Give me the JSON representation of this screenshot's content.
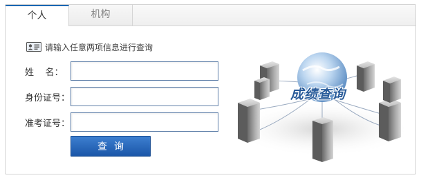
{
  "tabs": [
    {
      "label": "个人",
      "active": true
    },
    {
      "label": "机构",
      "active": false
    }
  ],
  "hint": {
    "text": "请输入任意两项信息进行查询",
    "icon": "id-card-icon"
  },
  "form": {
    "name_label": "姓    名：",
    "id_label": "身份证号：",
    "exam_label": "准考证号：",
    "name_value": "",
    "id_value": "",
    "exam_value": ""
  },
  "button": {
    "label": "查询"
  },
  "graphic": {
    "title": "成绩查询"
  },
  "colors": {
    "accent": "#1a56a8",
    "tab_border": "#1a67b4",
    "input_border": "#5d7ea8"
  }
}
